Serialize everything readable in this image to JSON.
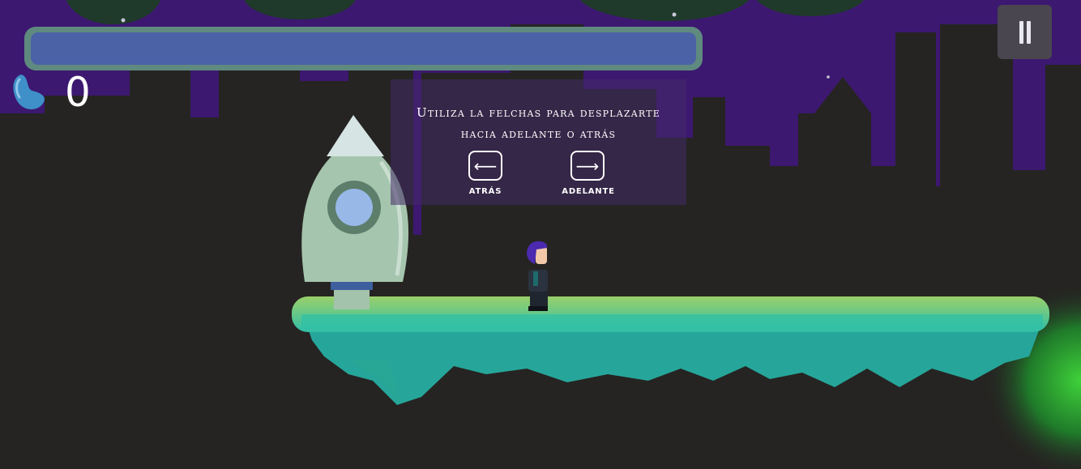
{
  "hud": {
    "progress_fraction": 1.0,
    "progress_color": "#4c62a6",
    "progress_frame_color": "#5f8a7f",
    "bean_count": "0",
    "bean_icon": "jelly-bean-icon",
    "pause_icon": "pause-icon"
  },
  "tutorial": {
    "line1": "Utiliza la felchas para desplazarte",
    "line2": "hacia adelante o atrás",
    "back_key_icon": "arrow-left-icon",
    "back_label": "ATRÁS",
    "forward_key_icon": "arrow-right-icon",
    "forward_label": "ADELANTE"
  },
  "colors": {
    "sky": "#3c1870",
    "city": "#252422",
    "platform": "#2ab8a6",
    "rocket": "#a6c5ae"
  }
}
